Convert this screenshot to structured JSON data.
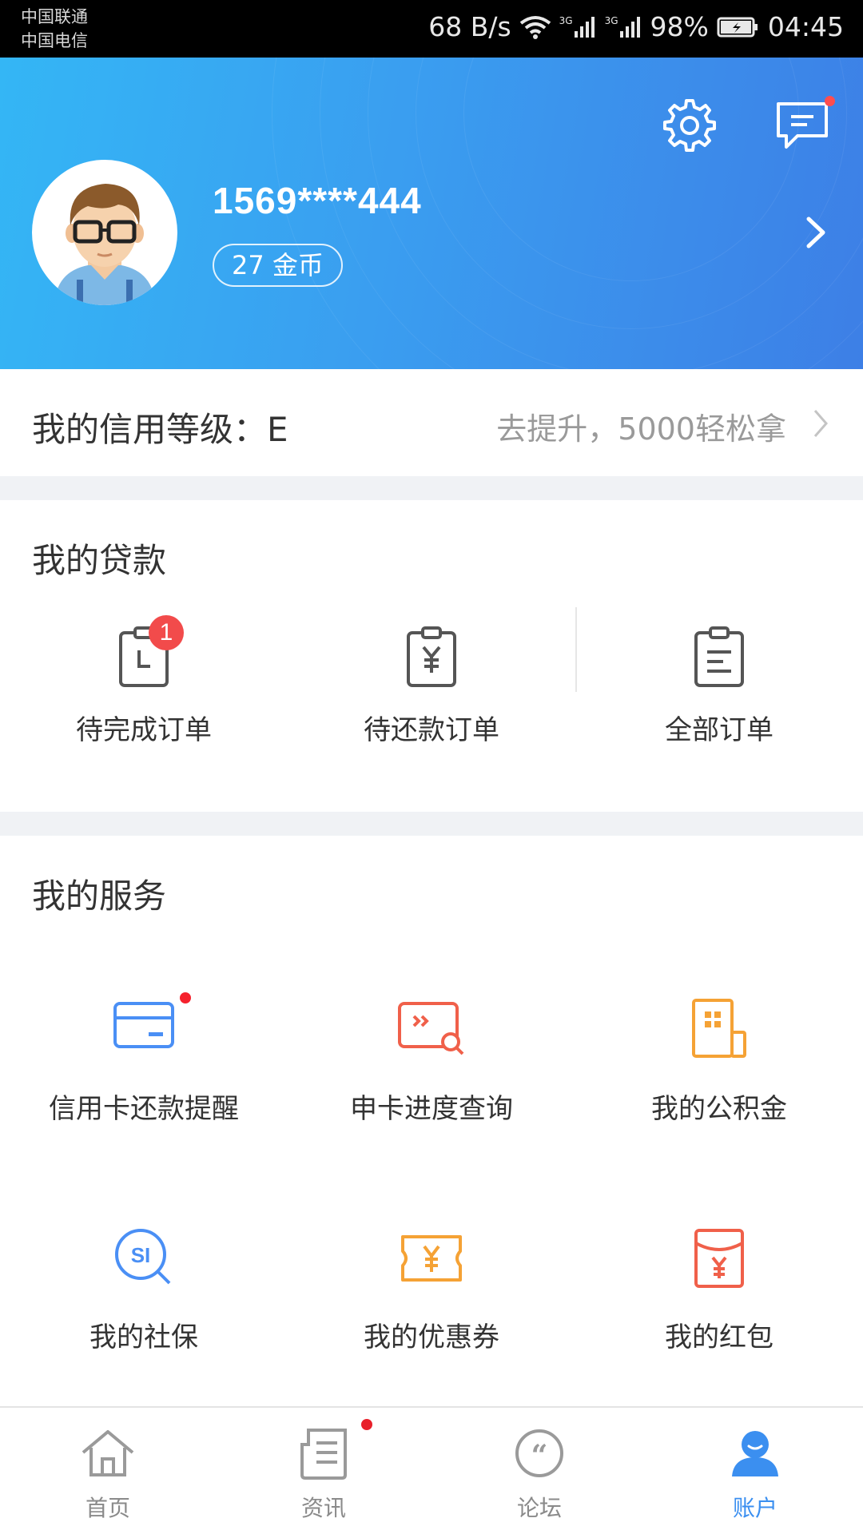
{
  "status_bar": {
    "carrier_1": "中国联通",
    "carrier_2": "中国电信",
    "net_speed": "68 B/s",
    "network_1": "3G",
    "network_2": "3G",
    "battery": "98%",
    "time": "04:45"
  },
  "header": {
    "username": "1569****444",
    "coins": "27 金币",
    "icons": [
      "settings-icon",
      "message-icon",
      "chevron-right-icon"
    ],
    "has_message_dot": true
  },
  "credit": {
    "label": "我的信用等级：E",
    "promo": "去提升，5000轻松拿"
  },
  "loans": {
    "title": "我的贷款",
    "items": [
      {
        "label": "待完成订单",
        "icon": "pending-order-icon",
        "badge": "1"
      },
      {
        "label": "待还款订单",
        "icon": "repayment-order-icon"
      },
      {
        "label": "全部订单",
        "icon": "all-orders-icon"
      }
    ]
  },
  "services": {
    "title": "我的服务",
    "items": [
      {
        "label": "信用卡还款提醒",
        "icon": "credit-card-icon",
        "dot": true,
        "color": "#4a8ff5"
      },
      {
        "label": "申卡进度查询",
        "icon": "card-progress-search-icon",
        "color": "#f0604a"
      },
      {
        "label": "我的公积金",
        "icon": "building-icon",
        "color": "#f5a235"
      },
      {
        "label": "我的社保",
        "icon": "social-security-icon",
        "color": "#4a8ff5"
      },
      {
        "label": "我的优惠券",
        "icon": "coupon-icon",
        "color": "#f5a235"
      },
      {
        "label": "我的红包",
        "icon": "red-envelope-icon",
        "color": "#f0604a"
      }
    ]
  },
  "nav": {
    "items": [
      {
        "label": "首页",
        "icon": "home-icon"
      },
      {
        "label": "资讯",
        "icon": "news-icon",
        "dot": true
      },
      {
        "label": "论坛",
        "icon": "forum-icon"
      },
      {
        "label": "账户",
        "icon": "account-icon",
        "active": true
      }
    ],
    "active_color": "#3b8ff0",
    "inactive_color": "#8a8a8a"
  },
  "colors": {
    "header_gradient_start": "#34b6f5",
    "header_gradient_end": "#3d7fe6",
    "badge_red": "#f24b4b"
  }
}
